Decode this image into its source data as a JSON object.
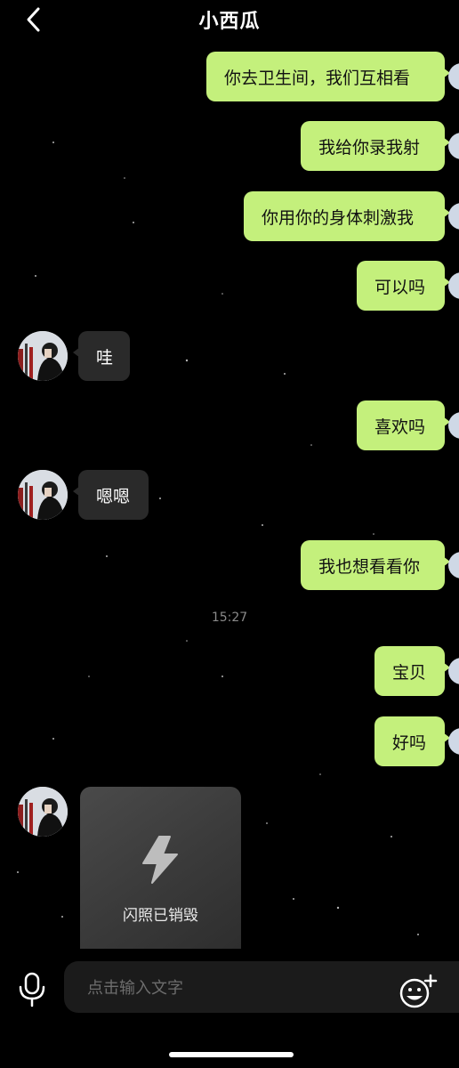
{
  "header": {
    "title": "小西瓜"
  },
  "messages": {
    "m1": "你去卫生间，我们互相看",
    "m2": "我给你录我射",
    "m3": "你用你的身体刺激我",
    "m4": "可以吗",
    "m5": "哇",
    "m6": "喜欢吗",
    "m7": "嗯嗯",
    "m8": "我也想看看你",
    "m9": "宝贝",
    "m10": "好吗"
  },
  "timestamp": "15:27",
  "flash": {
    "label": "闪照已销毁"
  },
  "composer": {
    "placeholder": "点击输入文字"
  },
  "colors": {
    "sent_bubble": "#c4f07c",
    "received_bubble": "#2a2a2a",
    "background": "#000000"
  },
  "icons": {
    "back": "chevron-left-icon",
    "microphone": "microphone-icon",
    "emoji": "emoji-add-icon",
    "flash": "lightning-icon"
  }
}
